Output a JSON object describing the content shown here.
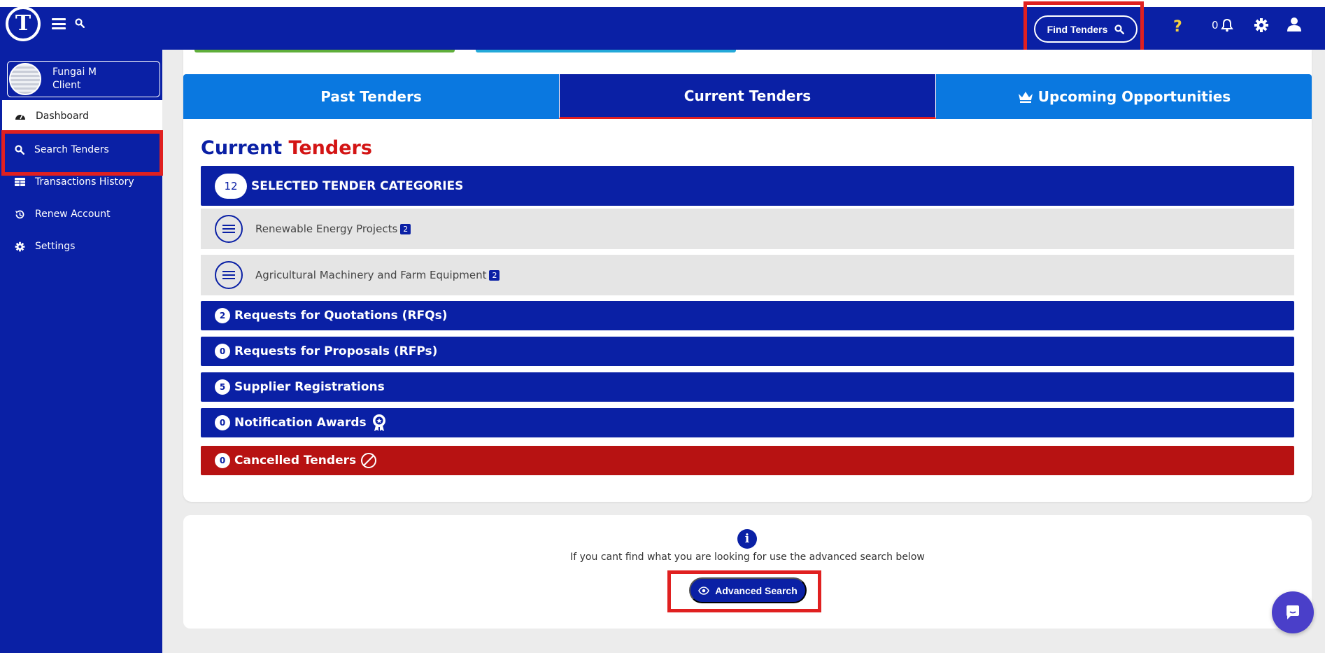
{
  "header": {
    "logo_letter": "T",
    "find_tenders_label": "Find Tenders",
    "help_symbol": "?",
    "notification_count": "0"
  },
  "sidebar": {
    "profile": {
      "name": "Fungai M",
      "role": "Client"
    },
    "items": [
      {
        "label": "Dashboard",
        "icon": "speedometer-icon"
      },
      {
        "label": "Search Tenders",
        "icon": "search-icon"
      },
      {
        "label": "Transactions History",
        "icon": "table-icon"
      },
      {
        "label": "Renew Account",
        "icon": "history-icon"
      },
      {
        "label": "Settings",
        "icon": "gear-icon"
      }
    ]
  },
  "tabs": [
    {
      "label": "Past Tenders"
    },
    {
      "label": "Current Tenders"
    },
    {
      "label": "Upcoming Opportunities",
      "icon": "crown-icon"
    }
  ],
  "main": {
    "title_part1": "Current",
    "title_part2": "Tenders",
    "categories_bar": {
      "count": "12",
      "label": "SELECTED TENDER CATEGORIES"
    },
    "categories": [
      {
        "label": "Renewable Energy Projects",
        "count": "2"
      },
      {
        "label": "Agricultural Machinery and Farm Equipment",
        "count": "2"
      }
    ],
    "rows": [
      {
        "count": "2",
        "label": "Requests for Quotations (RFQs)"
      },
      {
        "count": "0",
        "label": "Requests for Proposals (RFPs)"
      },
      {
        "count": "5",
        "label": "Supplier Registrations"
      },
      {
        "count": "0",
        "label": "Notification Awards"
      },
      {
        "count": "0",
        "label": "Cancelled Tenders"
      }
    ]
  },
  "advanced": {
    "info_text": "If you cant find what you are looking for use the advanced search below",
    "button_label": "Advanced Search"
  },
  "colors": {
    "primary": "#0a20a5",
    "accent_red": "#e02020",
    "cancelled": "#b71212",
    "tab_blue": "#0a78e0"
  }
}
